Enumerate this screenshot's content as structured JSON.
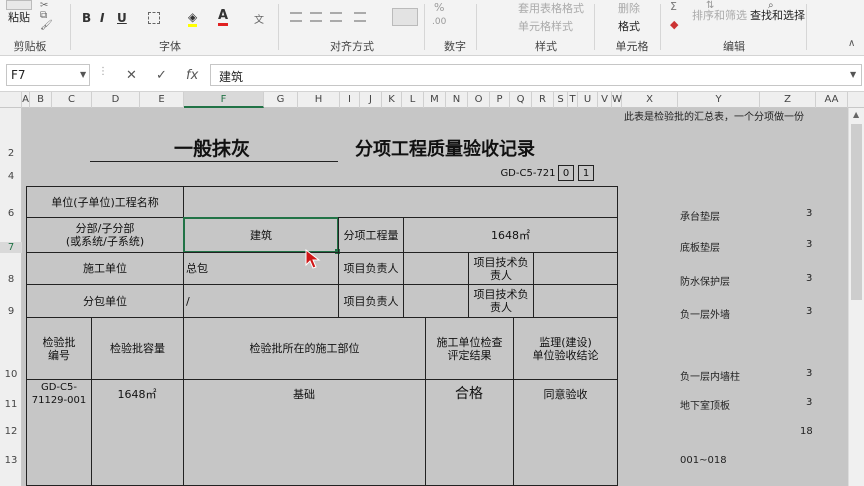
{
  "ribbon": {
    "clipboard": {
      "paste": "粘贴",
      "group": "剪贴板"
    },
    "font": {
      "bold": "B",
      "italic": "I",
      "underline": "U",
      "group": "字体"
    },
    "alignment": {
      "group": "对齐方式"
    },
    "number": {
      "group": "数字"
    },
    "styles": {
      "table_format": "套用表格格式",
      "cell_style": "单元格样式",
      "group": "样式"
    },
    "cells": {
      "delete": "删除",
      "format": "格式",
      "group": "单元格"
    },
    "editing": {
      "sort_filter": "排序和筛选",
      "find_select": "查找和选择",
      "group": "编辑"
    }
  },
  "formula_bar": {
    "name_box": "F7",
    "cancel": "✕",
    "enter": "✓",
    "fx": "fx",
    "value": "建筑"
  },
  "columns": [
    "A",
    "B",
    "C",
    "D",
    "E",
    "F",
    "G",
    "H",
    "I",
    "J",
    "K",
    "L",
    "M",
    "N",
    "O",
    "P",
    "Q",
    "R",
    "S",
    "T",
    "U",
    "V",
    "W",
    "X",
    "Y",
    "Z",
    "AA"
  ],
  "rows": [
    "2",
    "4",
    "6",
    "7",
    "8",
    "9",
    "10",
    "11",
    "12",
    "13"
  ],
  "sheet": {
    "title_left": "一般抹灰",
    "title_right": "分项工程质量验收记录",
    "code": "GD-C5-721",
    "code_box1": "0",
    "code_box2": "1",
    "unit_name_label": "单位(子单位)工程名称",
    "sub_label": "分部/子分部\n(或系统/子系统)",
    "sub_value": "建筑",
    "item_label": "分项工程量",
    "item_value": "1648㎡",
    "contractor_label": "施工单位",
    "contractor_value": "总包",
    "pm_label": "项目负责人",
    "tech_label": "项目技术负责人",
    "subcontractor_label": "分包单位",
    "subcontractor_value": "/",
    "pm_label2": "项目负责人",
    "tech_label2": "项目技术负责人",
    "hdr_batch_no": "检验批\n编号",
    "hdr_capacity": "检验批容量",
    "hdr_location": "检验批所在的施工部位",
    "hdr_result": "施工单位检查\n评定结果",
    "hdr_conclusion": "监理(建设)\n单位验收结论",
    "r1_no": "GD-C5-\n71129-001",
    "r1_capacity": "1648㎡",
    "r1_location": "基础",
    "r1_result": "合格",
    "r1_conclusion": "同意验收",
    "note": "此表是检验批的汇总表，一个分项做一份",
    "side_items": [
      {
        "name": "承台垫层",
        "count": "3"
      },
      {
        "name": "底板垫层",
        "count": "3"
      },
      {
        "name": "防水保护层",
        "count": "3"
      },
      {
        "name": "负一层外墙",
        "count": "3"
      },
      {
        "name": "负一层内墙柱",
        "count": "3"
      },
      {
        "name": "地下室顶板",
        "count": "3"
      }
    ],
    "total": "18",
    "range": "001~018"
  }
}
